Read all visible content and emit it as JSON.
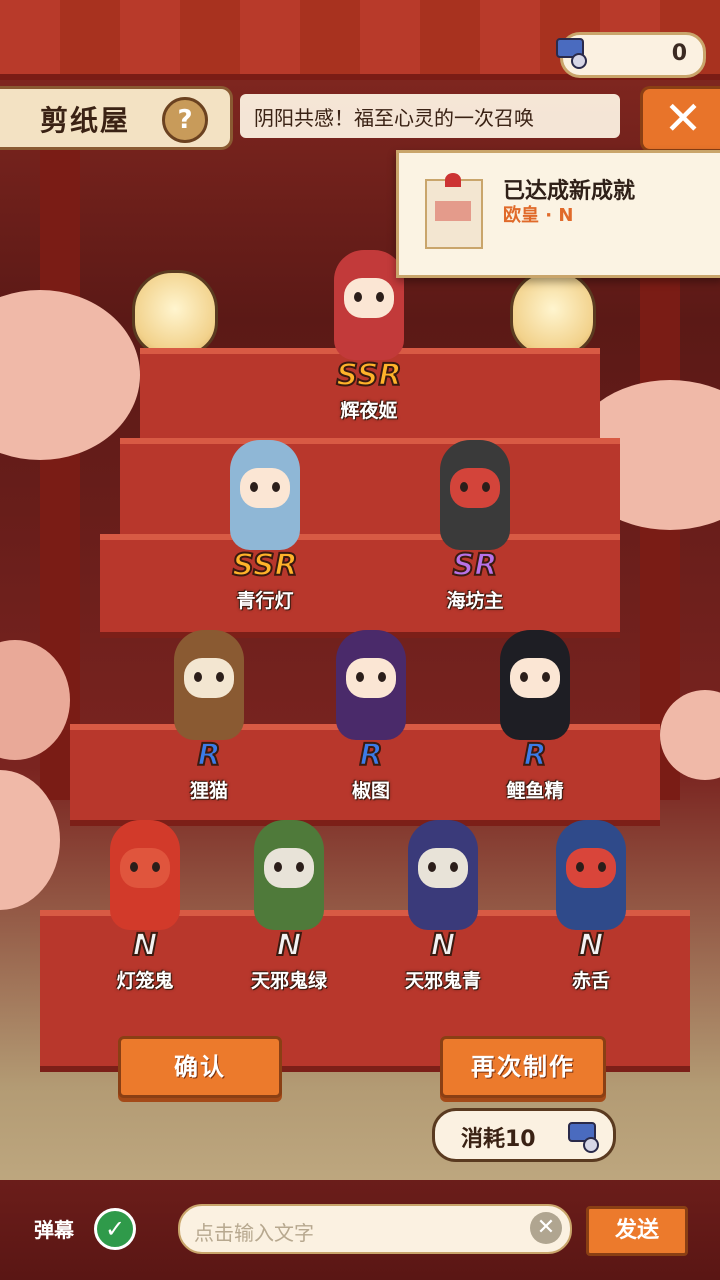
{
  "currency": {
    "amount": "0",
    "icon": "ticket-icon"
  },
  "header": {
    "title": "剪纸屋",
    "help_label": "?",
    "marquee": "阴阳共感！福至心灵的一次召唤",
    "close_label": "✕"
  },
  "toast": {
    "title": "已达成新成就",
    "subtitle": "欧皇 · N"
  },
  "characters": [
    {
      "name": "辉夜姬",
      "rarity": "SSR"
    },
    {
      "name": "青行灯",
      "rarity": "SSR"
    },
    {
      "name": "海坊主",
      "rarity": "SR"
    },
    {
      "name": "狸猫",
      "rarity": "R"
    },
    {
      "name": "椒图",
      "rarity": "R"
    },
    {
      "name": "鲤鱼精",
      "rarity": "R"
    },
    {
      "name": "灯笼鬼",
      "rarity": "N"
    },
    {
      "name": "天邪鬼绿",
      "rarity": "N"
    },
    {
      "name": "天邪鬼青",
      "rarity": "N"
    },
    {
      "name": "赤舌",
      "rarity": "N"
    }
  ],
  "actions": {
    "confirm_label": "确认",
    "retry_label": "再次制作",
    "cost_label": "消耗10"
  },
  "chat": {
    "danmu_label": "弹幕",
    "danmu_enabled": true,
    "placeholder": "点击输入文字",
    "send_label": "发送"
  },
  "colors": {
    "accent": "#ec7a2c",
    "ssr": "#ffb32a",
    "sr": "#b872e8",
    "r": "#3b7be8",
    "n": "#f2f2f2"
  }
}
